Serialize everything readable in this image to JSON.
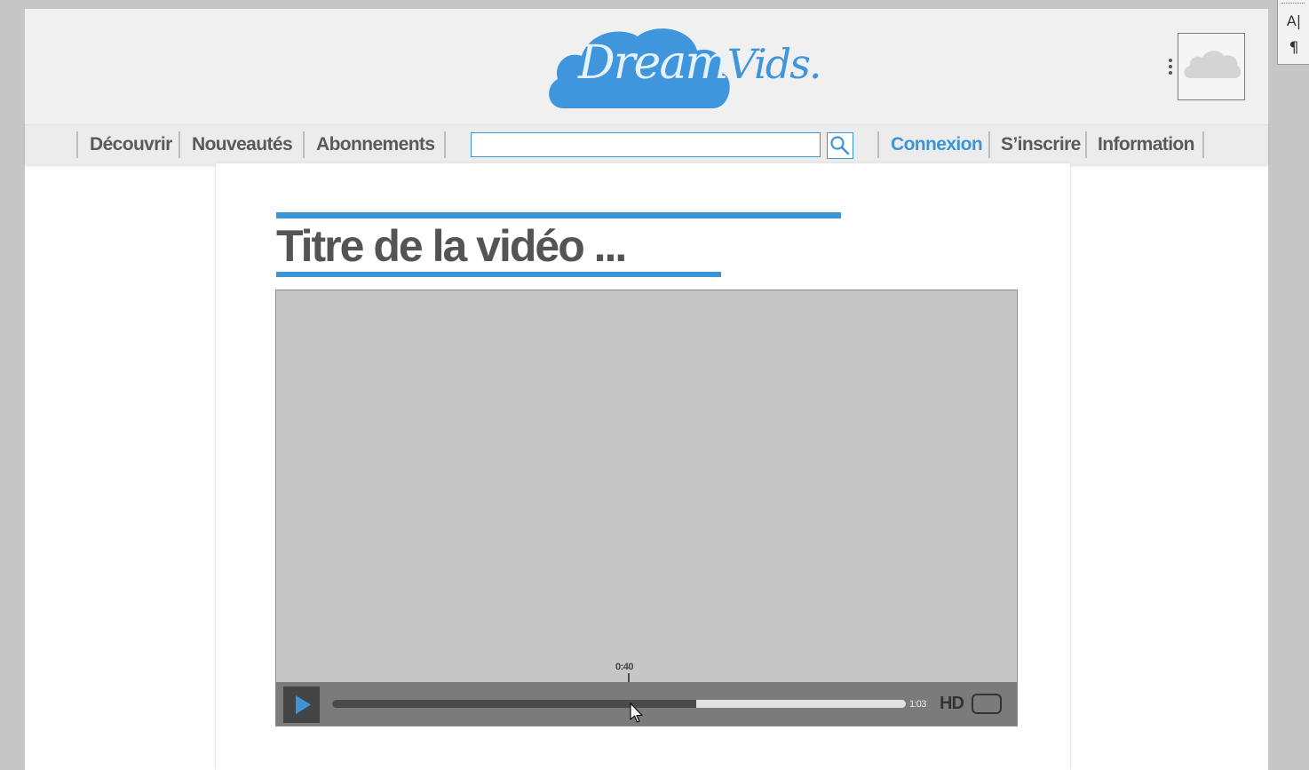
{
  "header": {
    "logo": {
      "text_part1": "Dream",
      "text_part2": "Vids."
    },
    "avatar_icon": "cloud-icon",
    "menu_icon": "kebab-icon"
  },
  "nav": {
    "left_items": [
      "Découvrir",
      "Nouveautés",
      "Abonnements"
    ],
    "search": {
      "value": "",
      "placeholder": ""
    },
    "search_icon": "magnifier-icon",
    "right_items": [
      "Connexion",
      "S’inscrire",
      "Information"
    ],
    "active_item": "Connexion"
  },
  "video": {
    "title": "Titre de la vidéo ...",
    "current_time": "0:40",
    "duration": "1:03",
    "progress_fraction": 0.635,
    "quality_label": "HD",
    "play_icon": "play-icon",
    "fullscreen_icon": "fullscreen-icon"
  },
  "side_tools": {
    "items": [
      "A|",
      "¶"
    ]
  },
  "colors": {
    "accent": "#3c96d6",
    "header_bg": "#f0f0f0",
    "text": "#545454",
    "player_bg": "#c6c6c6",
    "controls_bg": "#7b7b7b"
  }
}
